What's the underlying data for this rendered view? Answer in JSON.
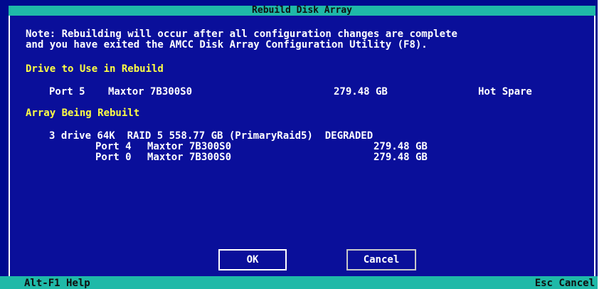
{
  "title": "Rebuild Disk Array",
  "note_line1": "Note: Rebuilding will occur after all configuration changes are complete",
  "note_line2": "and you have exited the AMCC Disk Array Configuration Utility (F8).",
  "drive_section": {
    "heading": "Drive to Use in Rebuild",
    "port": "Port 5",
    "model": "Maxtor 7B300S0",
    "size": "279.48 GB",
    "role": "Hot Spare"
  },
  "array_section": {
    "heading": "Array Being Rebuilt",
    "summary": "3 drive 64K  RAID 5 558.77 GB (PrimaryRaid5)  DEGRADED",
    "members": [
      {
        "port": "Port 4",
        "model": "Maxtor 7B300S0",
        "size": "279.48 GB"
      },
      {
        "port": "Port 0",
        "model": "Maxtor 7B300S0",
        "size": "279.48 GB"
      }
    ]
  },
  "buttons": {
    "ok": "OK",
    "cancel": "Cancel"
  },
  "status": {
    "left_key": "Alt-F1",
    "left_label": "Help",
    "right_key": "Esc",
    "right_label": "Cancel"
  },
  "colors": {
    "background": "#000a8f",
    "heading": "#ffff44",
    "text": "#ffffff",
    "bar": "#1fb9a8"
  }
}
